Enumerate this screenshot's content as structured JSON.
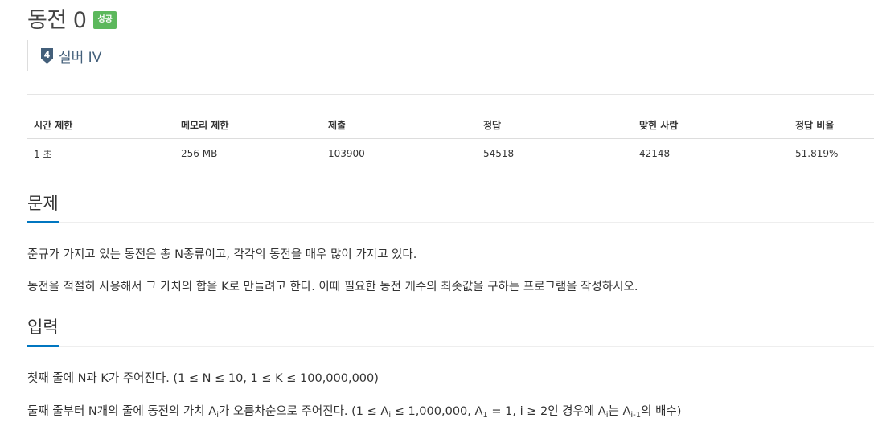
{
  "problem": {
    "title": "동전 0",
    "status_badge": "성공",
    "tier": {
      "level": "4",
      "name": "실버 IV",
      "icon": "silver-tier-icon",
      "color": "#435f7a"
    }
  },
  "info_table": {
    "headers": [
      "시간 제한",
      "메모리 제한",
      "제출",
      "정답",
      "맞힌 사람",
      "정답 비율"
    ],
    "values": [
      "1 초",
      "256 MB",
      "103900",
      "54518",
      "42148",
      "51.819%"
    ]
  },
  "sections": {
    "description": {
      "title": "문제",
      "paragraphs": [
        "준규가 가지고 있는 동전은 총 N종류이고, 각각의 동전을 매우 많이 가지고 있다.",
        "동전을 적절히 사용해서 그 가치의 합을 K로 만들려고 한다. 이때 필요한 동전 개수의 최솟값을 구하는 프로그램을 작성하시오."
      ]
    },
    "input": {
      "title": "입력",
      "line1": "첫째 줄에 N과 K가 주어진다. (1 ≤ N ≤ 10, 1 ≤ K ≤ 100,000,000)",
      "line2": {
        "p1": "둘째 줄부터 N개의 줄에 동전의 가치 A",
        "s1": "i",
        "p2": "가 오름차순으로 주어진다. (1 ≤ A",
        "s2": "i",
        "p3": " ≤ 1,000,000, A",
        "s3": "1",
        "p4": " = 1, i ≥ 2인 경우에 A",
        "s4": "i",
        "p5": "는 A",
        "s5": "i-1",
        "p6": "의 배수)"
      }
    }
  },
  "colors": {
    "success": "#5cb85c",
    "accent": "#0076c0"
  }
}
